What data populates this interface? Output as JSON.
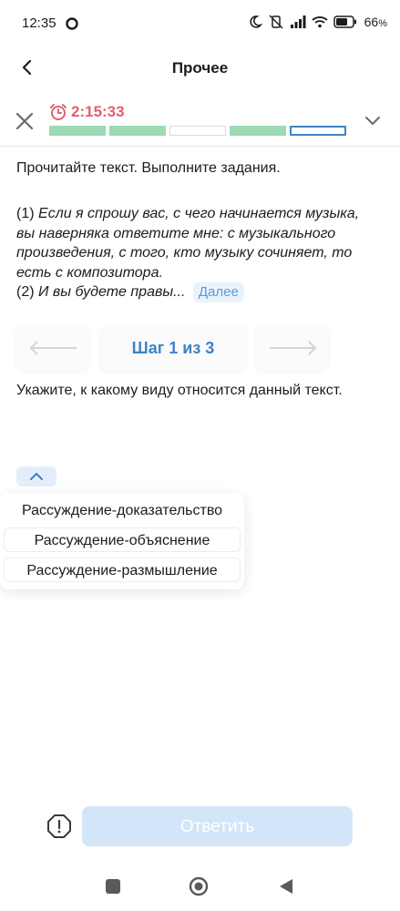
{
  "status_bar": {
    "time": "12:35",
    "battery_percent": "66",
    "battery_suffix": "%"
  },
  "appbar": {
    "title": "Прочее"
  },
  "progress": {
    "timer": "2:15:33",
    "timer_color": "#e0636d",
    "segments": [
      "done",
      "done",
      "empty",
      "done",
      "current"
    ],
    "done_color": "#9dd9b4",
    "current_color": "#3d84c6"
  },
  "task": {
    "instruction": "Прочитайте текст. Выполните задания.",
    "sentence1_num": "(1)",
    "sentence1_text": "Если я спрошу вас, с чего начинается музыка, вы наверняка ответите мне: с музыкального произведения, с того, кто музыку сочиняет, то есть с композитора.",
    "sentence2_num": "(2)",
    "sentence2_text": "И вы будете правы...",
    "more_label": "Далее"
  },
  "stepper": {
    "label": "Шаг 1 из 3"
  },
  "question": {
    "text": "Укажите, к какому виду относится данный текст."
  },
  "options": [
    "Рассуждение-доказательство",
    "Рассуждение-объяснение",
    "Рассуждение-размышление"
  ],
  "footer": {
    "answer_label": "Ответить",
    "answer_color": "#d3e5f8"
  }
}
